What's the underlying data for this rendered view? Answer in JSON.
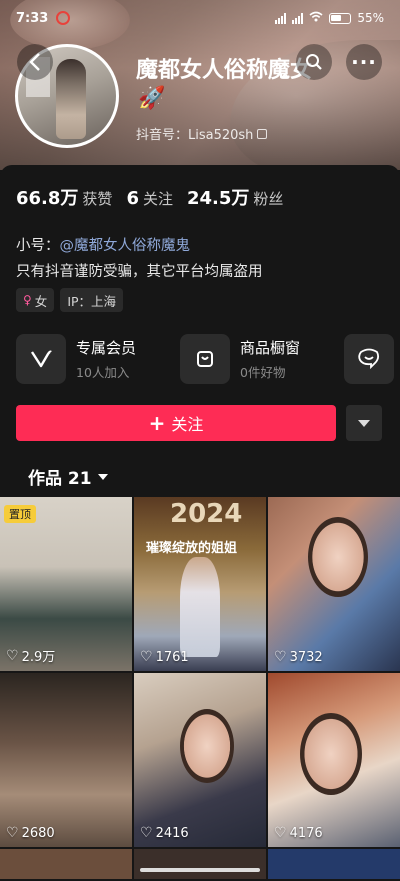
{
  "status_bar": {
    "time": "7:33",
    "battery": "55"
  },
  "profile": {
    "name": "魔都女人俗称魔女",
    "name_emoji": "🚀",
    "douyin_id": "抖音号：Lisa520sh",
    "stats": [
      {
        "value": "66.8万",
        "label": "获赞"
      },
      {
        "value": "6",
        "label": "关注"
      },
      {
        "value": "24.5万",
        "label": "粉丝"
      }
    ],
    "alias_prefix": "小号：",
    "alias_link": "@魔都女人俗称魔鬼",
    "bio": "只有抖音谨防受骗，其它平台均属盗用",
    "tags": {
      "gender": "女",
      "ip": "IP：上海"
    }
  },
  "features": [
    {
      "title": "专属会员",
      "subtitle": "10人加入",
      "icon": "v-icon"
    },
    {
      "title": "商品橱窗",
      "subtitle": "0件好物",
      "icon": "bag-icon"
    }
  ],
  "follow_label": "关注",
  "works_tab": "作品 21",
  "grid": [
    {
      "likes": "2.9万",
      "pinned": "置顶"
    },
    {
      "likes": "1761",
      "year": "2024",
      "banner": "璀璨绽放的姐姐"
    },
    {
      "likes": "3732"
    },
    {
      "likes": "2680"
    },
    {
      "likes": "2416"
    },
    {
      "likes": "4176"
    }
  ],
  "colors": {
    "accent": "#fe2c55",
    "background": "#161616",
    "pin": "#f6cc3a"
  }
}
